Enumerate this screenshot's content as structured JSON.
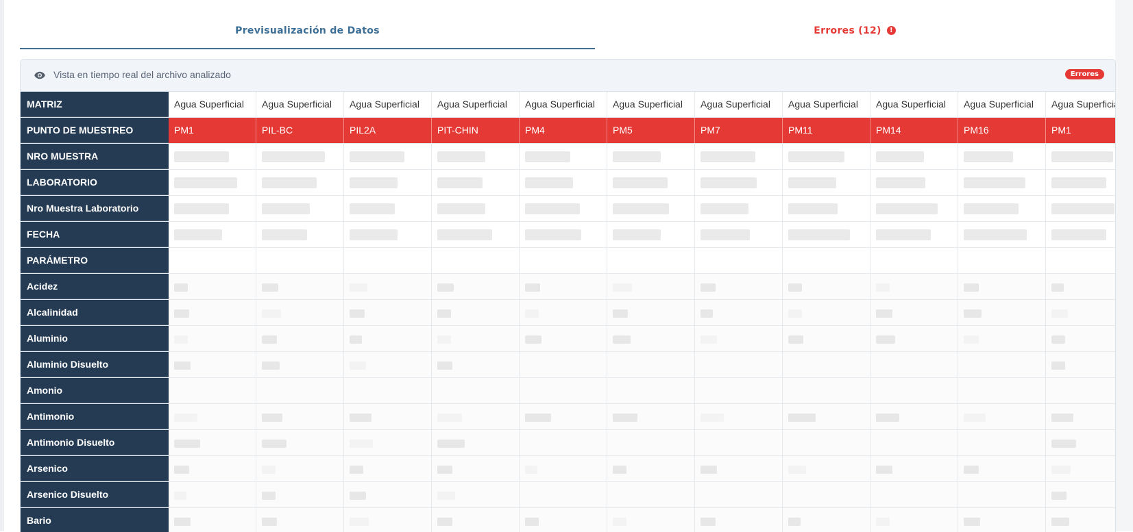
{
  "tabs": {
    "preview_label": "Previsualización de Datos",
    "errors_label": "Errores (12)",
    "errors_icon": "!"
  },
  "panel": {
    "title": "Vista en tiempo real del archivo analizado",
    "badge": "Errores"
  },
  "colors": {
    "header_bg": "#243b53",
    "error_red": "#e53935",
    "accent_blue": "#3d6f96"
  },
  "table": {
    "rows": [
      {
        "label": "MATRIZ",
        "type": "text",
        "values": [
          "Agua Superficial",
          "Agua Superficial",
          "Agua Superficial",
          "Agua Superficial",
          "Agua Superficial",
          "Agua Superficial",
          "Agua Superficial",
          "Agua Superficial",
          "Agua Superficial",
          "Agua Superficial",
          "Agua Superficial"
        ]
      },
      {
        "label": "PUNTO DE MUESTREO",
        "type": "error",
        "values": [
          "PM1",
          "PIL-BC",
          "PIL2A",
          "PIT-CHIN",
          "PM4",
          "PM5",
          "PM7",
          "PM11",
          "PM14",
          "PM16",
          "PM1"
        ]
      },
      {
        "label": "NRO MUESTRA",
        "type": "redacted"
      },
      {
        "label": "LABORATORIO",
        "type": "redacted"
      },
      {
        "label": "Nro Muestra Laboratorio",
        "type": "redacted"
      },
      {
        "label": "FECHA",
        "type": "redacted"
      },
      {
        "label": "PARÁMETRO",
        "type": "param"
      },
      {
        "label": "Acidez",
        "type": "value"
      },
      {
        "label": "Alcalinidad",
        "type": "value"
      },
      {
        "label": "Aluminio",
        "type": "value"
      },
      {
        "label": "Aluminio Disuelto",
        "type": "value"
      },
      {
        "label": "Amonio",
        "type": "value"
      },
      {
        "label": "Antimonio",
        "type": "value"
      },
      {
        "label": "Antimonio Disuelto",
        "type": "value"
      },
      {
        "label": "Arsenico",
        "type": "value"
      },
      {
        "label": "Arsenico Disuelto",
        "type": "value"
      },
      {
        "label": "Bario",
        "type": "value"
      }
    ]
  }
}
